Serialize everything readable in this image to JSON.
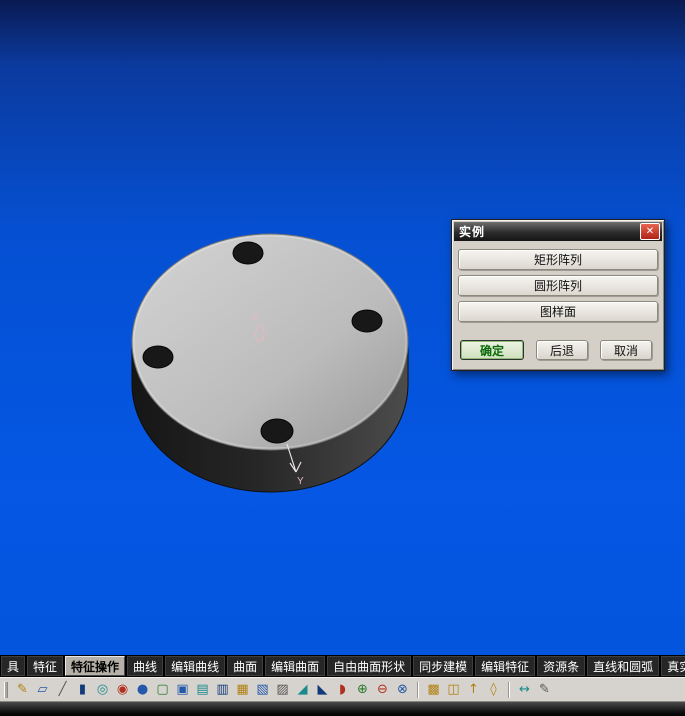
{
  "viewport": {
    "axis_z_label": "Z",
    "axis_y_label": "Y"
  },
  "dialog": {
    "title": "实例",
    "close_glyph": "✕",
    "option_buttons": [
      "矩形阵列",
      "圆形阵列",
      "图样面"
    ],
    "ok_label": "确定",
    "back_label": "后退",
    "cancel_label": "取消"
  },
  "tab_bar": {
    "selected": "特征操作",
    "tabs": [
      {
        "label": "具"
      },
      {
        "label": "特征"
      },
      {
        "label": "特征操作"
      },
      {
        "label": "曲线"
      },
      {
        "label": "编辑曲线"
      },
      {
        "label": "曲面"
      },
      {
        "label": "编辑曲面"
      },
      {
        "label": "自由曲面形状"
      },
      {
        "label": "同步建模"
      },
      {
        "label": "编辑特征"
      },
      {
        "label": "资源条"
      },
      {
        "label": "直线和圆弧"
      },
      {
        "label": "真实着色"
      }
    ]
  },
  "icon_bar": {
    "icons": [
      {
        "name": "sketch-icon",
        "glyph": "✎"
      },
      {
        "name": "datum-plane-icon",
        "glyph": "▱"
      },
      {
        "name": "datum-axis-icon",
        "glyph": "╱"
      },
      {
        "name": "extrude-icon",
        "glyph": "▮"
      },
      {
        "name": "revolve-icon",
        "glyph": "◎"
      },
      {
        "name": "hole-icon",
        "glyph": "◉"
      },
      {
        "name": "boss-icon",
        "glyph": "●"
      },
      {
        "name": "pocket-icon",
        "glyph": "▢"
      },
      {
        "name": "pad-icon",
        "glyph": "▣"
      },
      {
        "name": "slot-icon",
        "glyph": "▤"
      },
      {
        "name": "groove-icon",
        "glyph": "▥"
      },
      {
        "name": "rib-icon",
        "glyph": "▦"
      },
      {
        "name": "thread-icon",
        "glyph": "▧"
      },
      {
        "name": "shell-icon",
        "glyph": "▨"
      },
      {
        "name": "draft-icon",
        "glyph": "◢"
      },
      {
        "name": "chamfer-icon",
        "glyph": "◣"
      },
      {
        "name": "edge-blend-icon",
        "glyph": "◗"
      },
      {
        "name": "unite-icon",
        "glyph": "⊕"
      },
      {
        "name": "subtract-icon",
        "glyph": "⊖"
      },
      {
        "name": "intersect-icon",
        "glyph": "⊗"
      },
      {
        "name": "pattern-feature-icon",
        "glyph": "▩"
      },
      {
        "name": "mirror-feature-icon",
        "glyph": "◫"
      },
      {
        "name": "promote-body-icon",
        "glyph": "↑"
      },
      {
        "name": "patch-icon",
        "glyph": "◊"
      },
      {
        "name": "move-face-icon",
        "glyph": "↔"
      },
      {
        "name": "edit-pencil-icon",
        "glyph": "✎"
      }
    ]
  },
  "colors": {
    "ok_green": "#0a6a0a",
    "close_red": "#c03a2c",
    "viewport_blue_top": "#0a1a52",
    "viewport_blue_bottom": "#0557e4",
    "selected_tab_bg": "#b5b1a9",
    "dialog_bg": "#d4d0c8"
  }
}
